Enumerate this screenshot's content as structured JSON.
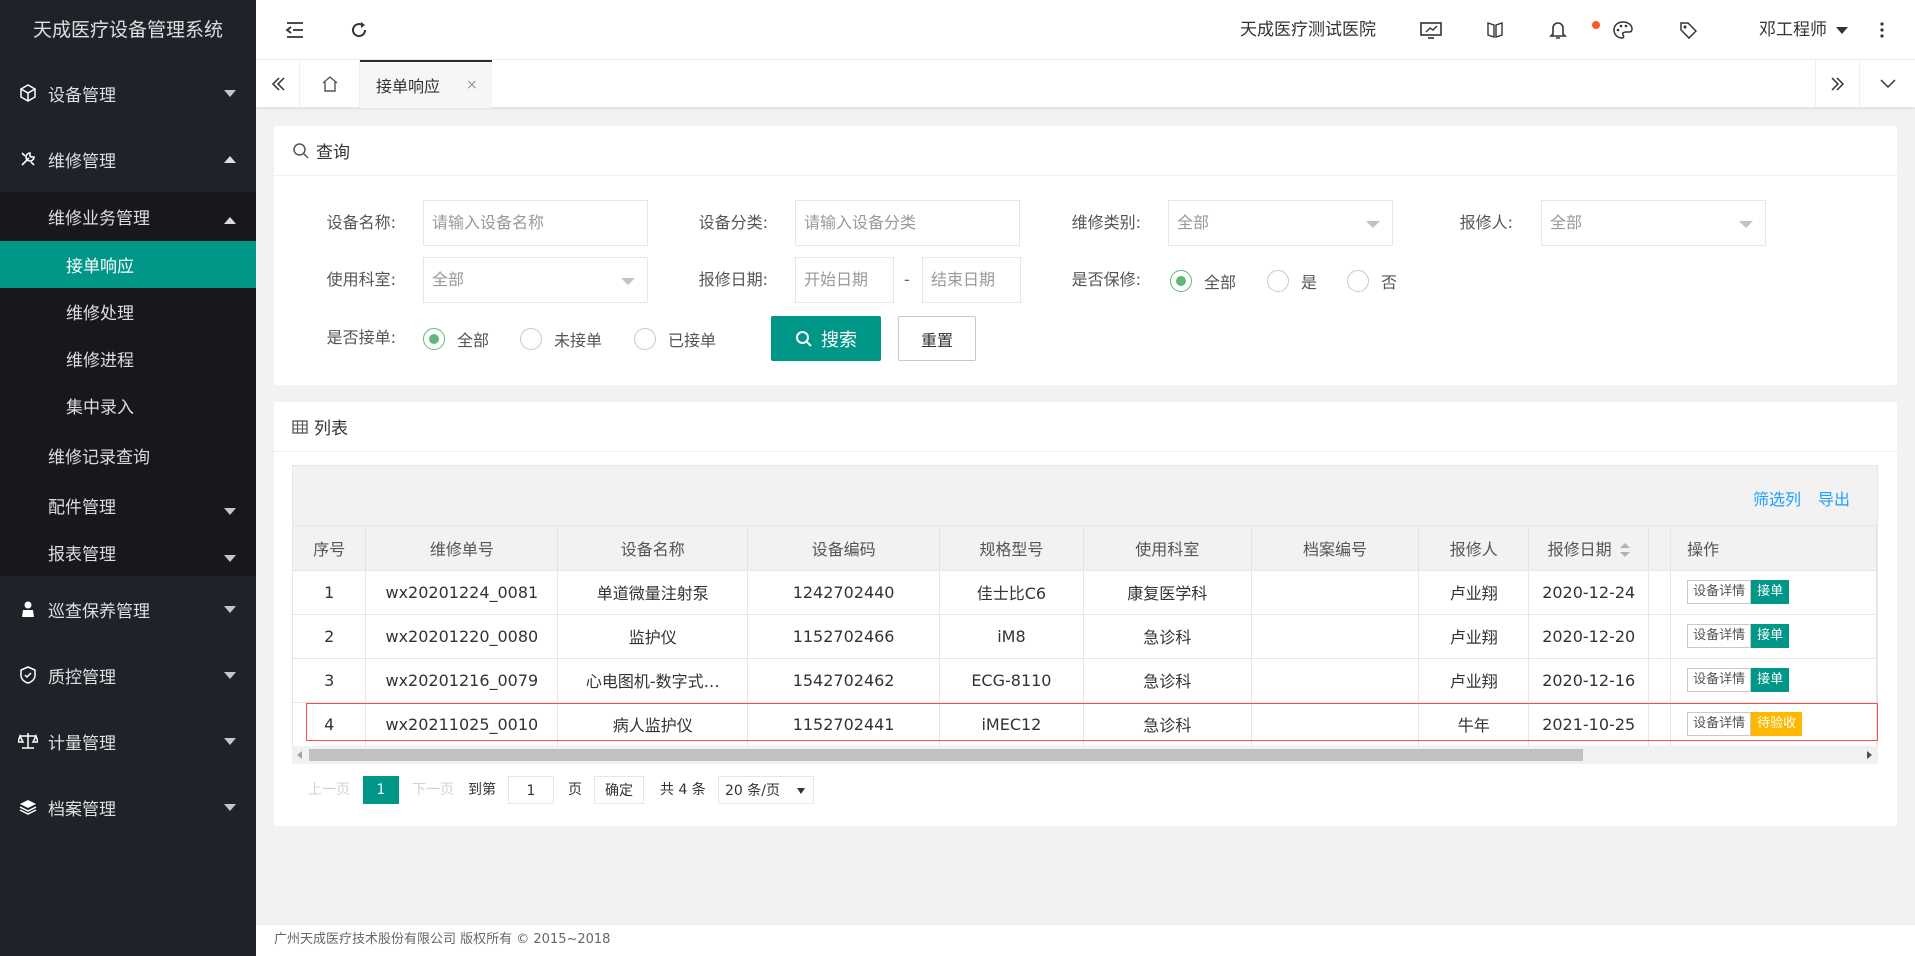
{
  "app": {
    "title": "天成医疗设备管理系统"
  },
  "sidebar": {
    "equipment": "设备管理",
    "repair": "维修管理",
    "repair_biz": "维修业务管理",
    "accept": "接单响应",
    "process": "维修处理",
    "progress": "维修进程",
    "central": "集中录入",
    "records": "维修记录查询",
    "parts": "配件管理",
    "reports": "报表管理",
    "inspection": "巡查保养管理",
    "quality": "质控管理",
    "metering": "计量管理",
    "archive": "档案管理"
  },
  "header": {
    "hospital": "天成医疗测试医院",
    "user": "邓工程师"
  },
  "tabs": {
    "active": "接单响应",
    "close": "×"
  },
  "query": {
    "title": "查询",
    "device_name_label": "设备名称:",
    "device_name_ph": "请输入设备名称",
    "device_cat_label": "设备分类:",
    "device_cat_ph": "请输入设备分类",
    "repair_type_label": "维修类别:",
    "repair_type_val": "全部",
    "reporter_label": "报修人:",
    "reporter_val": "全部",
    "dept_label": "使用科室:",
    "dept_val": "全部",
    "date_label": "报修日期:",
    "start_ph": "开始日期",
    "date_dash": "-",
    "end_ph": "结束日期",
    "warranty_label": "是否保修:",
    "warranty_opts": [
      "全部",
      "是",
      "否"
    ],
    "accepted_label": "是否接单:",
    "accepted_opts": [
      "全部",
      "未接单",
      "已接单"
    ],
    "search_btn": "搜索",
    "reset_btn": "重置"
  },
  "list": {
    "title": "列表",
    "filter_cols": "筛选列",
    "export": "导出",
    "headers": [
      "序号",
      "维修单号",
      "设备名称",
      "设备编码",
      "规格型号",
      "使用科室",
      "档案编号",
      "报修人",
      "报修日期",
      "",
      "操作"
    ],
    "rows": [
      {
        "no": "1",
        "order": "wx20201224_0081",
        "name": "单道微量注射泵",
        "code": "1242702440",
        "model": "佳士比C6",
        "dept": "康复医学科",
        "file": "",
        "reporter": "卢业翔",
        "date": "2020-12-24",
        "detail": "设备详情",
        "action": "接单"
      },
      {
        "no": "2",
        "order": "wx20201220_0080",
        "name": "监护仪",
        "code": "1152702466",
        "model": "iM8",
        "dept": "急诊科",
        "file": "",
        "reporter": "卢业翔",
        "date": "2020-12-20",
        "detail": "设备详情",
        "action": "接单"
      },
      {
        "no": "3",
        "order": "wx20201216_0079",
        "name": "心电图机-数字式…",
        "code": "1542702462",
        "model": "ECG-8110",
        "dept": "急诊科",
        "file": "",
        "reporter": "卢业翔",
        "date": "2020-12-16",
        "detail": "设备详情",
        "action": "接单"
      },
      {
        "no": "4",
        "order": "wx20211025_0010",
        "name": "病人监护仪",
        "code": "1152702441",
        "model": "iMEC12",
        "dept": "急诊科",
        "file": "",
        "reporter": "牛年",
        "date": "2021-10-25",
        "detail": "设备详情",
        "action": "待验收"
      }
    ]
  },
  "pager": {
    "prev": "上一页",
    "current": "1",
    "next": "下一页",
    "goto": "到第",
    "page_input": "1",
    "page_unit": "页",
    "confirm": "确定",
    "total": "共 4 条",
    "per_page": "20 条/页"
  },
  "footer": {
    "copyright": "广州天成医疗技术股份有限公司 版权所有 © 2015~2018"
  },
  "colors": {
    "accent": "#009688",
    "sidebar": "#20222a",
    "warn": "#ffb800",
    "link": "#1e9fff"
  }
}
